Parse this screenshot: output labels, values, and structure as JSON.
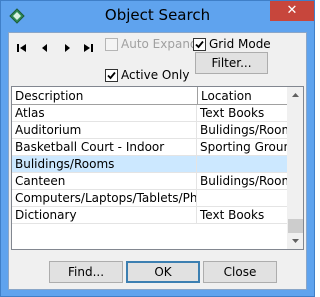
{
  "window": {
    "title": "Object Search",
    "close_glyph": "✕"
  },
  "toolbar": {
    "nav_icons": [
      "first-record-icon",
      "previous-record-icon",
      "next-record-icon",
      "last-record-icon"
    ],
    "auto_expand": {
      "label": "Auto Expand",
      "checked": false,
      "enabled": false
    },
    "grid_mode": {
      "label": "Grid Mode",
      "checked": true
    },
    "active_only": {
      "label": "Active Only",
      "checked": true
    },
    "filter_label": "Filter..."
  },
  "grid": {
    "columns": [
      "Description",
      "Location"
    ],
    "rows": [
      {
        "description": "Atlas",
        "location": "Text Books"
      },
      {
        "description": "Auditorium",
        "location": "Bulidings/Rooms"
      },
      {
        "description": "Basketball Court - Indoor",
        "location": "Sporting Grounds/..."
      },
      {
        "description": "Bulidings/Rooms",
        "location": "",
        "selected": true
      },
      {
        "description": "Canteen",
        "location": "Bulidings/Rooms"
      },
      {
        "description": "Computers/Laptops/Tablets/Phones",
        "location": ""
      },
      {
        "description": "Dictionary",
        "location": "Text Books"
      }
    ]
  },
  "footer": {
    "find_label": "Find...",
    "ok_label": "OK",
    "close_label": "Close"
  },
  "colors": {
    "titlebar": "#5fa3ee",
    "close_button": "#c7463c",
    "selection": "#cce8ff"
  }
}
